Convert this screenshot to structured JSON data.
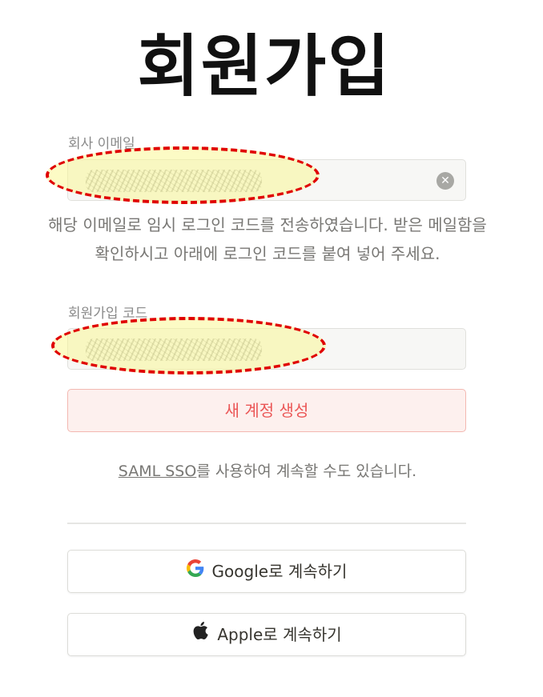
{
  "page": {
    "title": "회원가입"
  },
  "email": {
    "label": "회사 이메일",
    "value": "",
    "clear_icon": "clear-circle-icon"
  },
  "notice": {
    "text": "해당 이메일로 임시 로그인 코드를 전송하였습니다. 받은 메일함을 확인하시고 아래에 로그인 코드를 붙여 넣어 주세요."
  },
  "signup_code": {
    "label": "회원가입 코드",
    "value": ""
  },
  "create_account": {
    "label": "새 계정 생성"
  },
  "sso": {
    "link_text": "SAML SSO",
    "suffix": "를 사용하여 계속할 수도 있습니다."
  },
  "oauth": {
    "google_label": "Google로 계속하기",
    "apple_label": "Apple로 계속하기"
  },
  "colors": {
    "accent_red": "#eb5757",
    "annotation_red": "#e00000",
    "annotation_fill": "#faf896"
  }
}
